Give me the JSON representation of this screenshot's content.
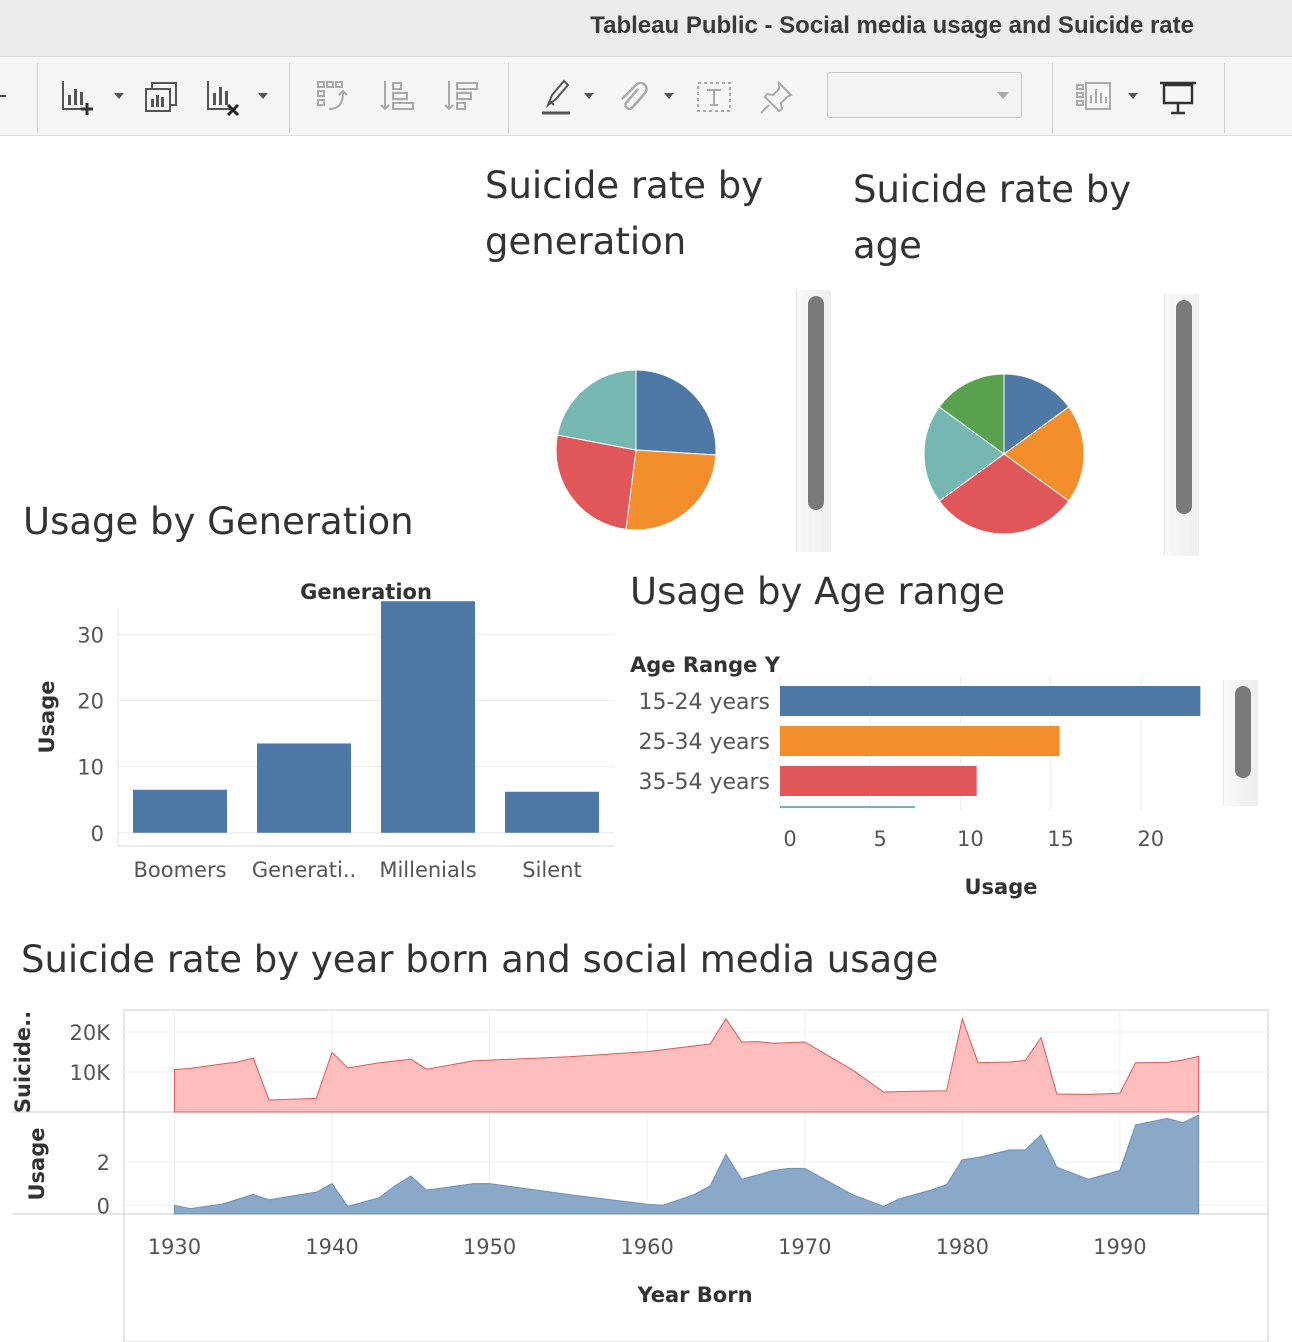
{
  "window": {
    "title": "Tableau Public - Social media usage and Suicide rate"
  },
  "toolbar": {
    "items": [
      "new-worksheet",
      "duplicate-sheet",
      "clear-sheet",
      "swap-rows-columns",
      "sort-ascending",
      "sort-descending",
      "highlight",
      "group-members",
      "show-mark-labels",
      "fix-axes",
      "fit-selector",
      "show-me",
      "presentation-mode"
    ],
    "fit_value": ""
  },
  "titles": {
    "pie_generation": [
      "Suicide rate by",
      "generation"
    ],
    "pie_age": [
      "Suicide rate by",
      "age"
    ],
    "usage_generation": "Usage by Generation",
    "usage_age": "Usage by Age range",
    "year_born": "Suicide rate by year born and social media usage"
  },
  "colors": {
    "blue": "#4e79a7",
    "orange": "#f28e2b",
    "red": "#e15759",
    "teal": "#76b7b2",
    "green": "#59a14f",
    "pink_fill": "#ffbdbd",
    "pink_line": "#e15759",
    "blue_area": "#8aa8c8"
  },
  "chart_data": [
    {
      "type": "pie",
      "title": "Suicide rate by generation",
      "slices": [
        {
          "value": 26,
          "color": "#4e79a7"
        },
        {
          "value": 26,
          "color": "#f28e2b"
        },
        {
          "value": 26,
          "color": "#e15759"
        },
        {
          "value": 22,
          "color": "#76b7b2"
        }
      ]
    },
    {
      "type": "pie",
      "title": "Suicide rate by age",
      "slices": [
        {
          "value": 15,
          "color": "#4e79a7"
        },
        {
          "value": 20,
          "color": "#f28e2b"
        },
        {
          "value": 30,
          "color": "#e15759"
        },
        {
          "value": 20,
          "color": "#76b7b2"
        },
        {
          "value": 15,
          "color": "#59a14f"
        }
      ]
    },
    {
      "type": "bar",
      "title": "Usage by Generation",
      "header": "Generation",
      "categories": [
        "Boomers",
        "Generati..",
        "Millenials",
        "Silent"
      ],
      "values": [
        6.5,
        13.5,
        35,
        6.2
      ],
      "ylabel": "Usage",
      "yticks": [
        0,
        10,
        20,
        30
      ],
      "ylim": [
        -2,
        37
      ],
      "grid": true
    },
    {
      "type": "bar",
      "orientation": "horizontal",
      "title": "Usage by Age range",
      "header": "Age Range Y",
      "categories": [
        "15-24 years",
        "25-34 years",
        "35-54 years"
      ],
      "values": [
        23.3,
        15.5,
        10.9
      ],
      "colors": [
        "#4e79a7",
        "#f28e2b",
        "#e15759"
      ],
      "xlabel": "Usage",
      "xticks": [
        0,
        5,
        10,
        15,
        20
      ],
      "xlim": [
        0,
        24.5
      ]
    },
    {
      "type": "area",
      "title": "Suicide rate by year born and social media usage",
      "xlabel": "Year Born",
      "xticks": [
        1930,
        1940,
        1950,
        1960,
        1970,
        1980,
        1990
      ],
      "xlim": [
        1926.8,
        1999.4
      ],
      "series": [
        {
          "name": "Suicide..",
          "yticks": [
            "10K",
            "20K"
          ],
          "ylim": [
            0,
            25000
          ],
          "points": [
            [
              1930,
              10600
            ],
            [
              1931,
              10900
            ],
            [
              1933,
              12000
            ],
            [
              1934,
              12500
            ],
            [
              1935,
              13500
            ],
            [
              1936,
              3000
            ],
            [
              1939,
              3400
            ],
            [
              1940,
              14900
            ],
            [
              1941,
              11000
            ],
            [
              1943,
              12300
            ],
            [
              1945,
              13200
            ],
            [
              1946,
              10700
            ],
            [
              1949,
              12800
            ],
            [
              1955,
              13800
            ],
            [
              1960,
              15100
            ],
            [
              1964,
              17000
            ],
            [
              1965,
              23300
            ],
            [
              1966,
              17500
            ],
            [
              1967,
              17600
            ],
            [
              1968,
              17200
            ],
            [
              1970,
              17500
            ],
            [
              1973,
              10600
            ],
            [
              1975,
              5000
            ],
            [
              1977,
              5200
            ],
            [
              1979,
              5300
            ],
            [
              1980,
              23300
            ],
            [
              1981,
              12300
            ],
            [
              1983,
              12500
            ],
            [
              1984,
              12900
            ],
            [
              1985,
              18600
            ],
            [
              1986,
              4500
            ],
            [
              1988,
              4400
            ],
            [
              1990,
              4700
            ],
            [
              1991,
              12300
            ],
            [
              1993,
              12400
            ],
            [
              1994,
              13000
            ],
            [
              1995,
              13900
            ]
          ]
        },
        {
          "name": "Usage",
          "yticks": [
            "0",
            "2"
          ],
          "ylim": [
            -0.4,
            4.2
          ],
          "points": [
            [
              1930,
              0.0
            ],
            [
              1931,
              -0.15
            ],
            [
              1933,
              0.05
            ],
            [
              1935,
              0.5
            ],
            [
              1936,
              0.25
            ],
            [
              1938,
              0.5
            ],
            [
              1939,
              0.6
            ],
            [
              1940,
              1.0
            ],
            [
              1941,
              -0.05
            ],
            [
              1943,
              0.35
            ],
            [
              1944,
              0.9
            ],
            [
              1945,
              1.35
            ],
            [
              1946,
              0.7
            ],
            [
              1948,
              0.9
            ],
            [
              1949,
              1.0
            ],
            [
              1950,
              1.0
            ],
            [
              1955,
              0.5
            ],
            [
              1960,
              0.05
            ],
            [
              1961,
              0.0
            ],
            [
              1963,
              0.5
            ],
            [
              1964,
              0.9
            ],
            [
              1965,
              2.35
            ],
            [
              1966,
              1.2
            ],
            [
              1968,
              1.6
            ],
            [
              1969,
              1.7
            ],
            [
              1970,
              1.7
            ],
            [
              1973,
              0.5
            ],
            [
              1975,
              -0.05
            ],
            [
              1976,
              0.3
            ],
            [
              1978,
              0.7
            ],
            [
              1979,
              0.95
            ],
            [
              1980,
              2.1
            ],
            [
              1981,
              2.2
            ],
            [
              1983,
              2.55
            ],
            [
              1984,
              2.55
            ],
            [
              1985,
              3.25
            ],
            [
              1986,
              1.75
            ],
            [
              1988,
              1.2
            ],
            [
              1990,
              1.6
            ],
            [
              1991,
              3.7
            ],
            [
              1993,
              4.0
            ],
            [
              1994,
              3.8
            ],
            [
              1995,
              4.15
            ]
          ]
        }
      ]
    }
  ]
}
